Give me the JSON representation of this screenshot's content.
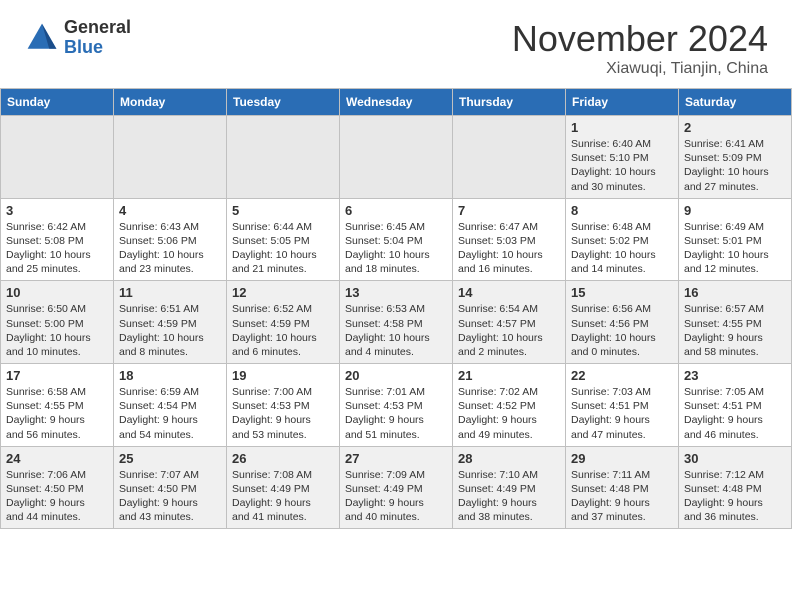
{
  "header": {
    "logo_general": "General",
    "logo_blue": "Blue",
    "month_title": "November 2024",
    "location": "Xiawuqi, Tianjin, China"
  },
  "weekdays": [
    "Sunday",
    "Monday",
    "Tuesday",
    "Wednesday",
    "Thursday",
    "Friday",
    "Saturday"
  ],
  "weeks": [
    [
      {
        "day": "",
        "info": ""
      },
      {
        "day": "",
        "info": ""
      },
      {
        "day": "",
        "info": ""
      },
      {
        "day": "",
        "info": ""
      },
      {
        "day": "",
        "info": ""
      },
      {
        "day": "1",
        "info": "Sunrise: 6:40 AM\nSunset: 5:10 PM\nDaylight: 10 hours\nand 30 minutes."
      },
      {
        "day": "2",
        "info": "Sunrise: 6:41 AM\nSunset: 5:09 PM\nDaylight: 10 hours\nand 27 minutes."
      }
    ],
    [
      {
        "day": "3",
        "info": "Sunrise: 6:42 AM\nSunset: 5:08 PM\nDaylight: 10 hours\nand 25 minutes."
      },
      {
        "day": "4",
        "info": "Sunrise: 6:43 AM\nSunset: 5:06 PM\nDaylight: 10 hours\nand 23 minutes."
      },
      {
        "day": "5",
        "info": "Sunrise: 6:44 AM\nSunset: 5:05 PM\nDaylight: 10 hours\nand 21 minutes."
      },
      {
        "day": "6",
        "info": "Sunrise: 6:45 AM\nSunset: 5:04 PM\nDaylight: 10 hours\nand 18 minutes."
      },
      {
        "day": "7",
        "info": "Sunrise: 6:47 AM\nSunset: 5:03 PM\nDaylight: 10 hours\nand 16 minutes."
      },
      {
        "day": "8",
        "info": "Sunrise: 6:48 AM\nSunset: 5:02 PM\nDaylight: 10 hours\nand 14 minutes."
      },
      {
        "day": "9",
        "info": "Sunrise: 6:49 AM\nSunset: 5:01 PM\nDaylight: 10 hours\nand 12 minutes."
      }
    ],
    [
      {
        "day": "10",
        "info": "Sunrise: 6:50 AM\nSunset: 5:00 PM\nDaylight: 10 hours\nand 10 minutes."
      },
      {
        "day": "11",
        "info": "Sunrise: 6:51 AM\nSunset: 4:59 PM\nDaylight: 10 hours\nand 8 minutes."
      },
      {
        "day": "12",
        "info": "Sunrise: 6:52 AM\nSunset: 4:59 PM\nDaylight: 10 hours\nand 6 minutes."
      },
      {
        "day": "13",
        "info": "Sunrise: 6:53 AM\nSunset: 4:58 PM\nDaylight: 10 hours\nand 4 minutes."
      },
      {
        "day": "14",
        "info": "Sunrise: 6:54 AM\nSunset: 4:57 PM\nDaylight: 10 hours\nand 2 minutes."
      },
      {
        "day": "15",
        "info": "Sunrise: 6:56 AM\nSunset: 4:56 PM\nDaylight: 10 hours\nand 0 minutes."
      },
      {
        "day": "16",
        "info": "Sunrise: 6:57 AM\nSunset: 4:55 PM\nDaylight: 9 hours\nand 58 minutes."
      }
    ],
    [
      {
        "day": "17",
        "info": "Sunrise: 6:58 AM\nSunset: 4:55 PM\nDaylight: 9 hours\nand 56 minutes."
      },
      {
        "day": "18",
        "info": "Sunrise: 6:59 AM\nSunset: 4:54 PM\nDaylight: 9 hours\nand 54 minutes."
      },
      {
        "day": "19",
        "info": "Sunrise: 7:00 AM\nSunset: 4:53 PM\nDaylight: 9 hours\nand 53 minutes."
      },
      {
        "day": "20",
        "info": "Sunrise: 7:01 AM\nSunset: 4:53 PM\nDaylight: 9 hours\nand 51 minutes."
      },
      {
        "day": "21",
        "info": "Sunrise: 7:02 AM\nSunset: 4:52 PM\nDaylight: 9 hours\nand 49 minutes."
      },
      {
        "day": "22",
        "info": "Sunrise: 7:03 AM\nSunset: 4:51 PM\nDaylight: 9 hours\nand 47 minutes."
      },
      {
        "day": "23",
        "info": "Sunrise: 7:05 AM\nSunset: 4:51 PM\nDaylight: 9 hours\nand 46 minutes."
      }
    ],
    [
      {
        "day": "24",
        "info": "Sunrise: 7:06 AM\nSunset: 4:50 PM\nDaylight: 9 hours\nand 44 minutes."
      },
      {
        "day": "25",
        "info": "Sunrise: 7:07 AM\nSunset: 4:50 PM\nDaylight: 9 hours\nand 43 minutes."
      },
      {
        "day": "26",
        "info": "Sunrise: 7:08 AM\nSunset: 4:49 PM\nDaylight: 9 hours\nand 41 minutes."
      },
      {
        "day": "27",
        "info": "Sunrise: 7:09 AM\nSunset: 4:49 PM\nDaylight: 9 hours\nand 40 minutes."
      },
      {
        "day": "28",
        "info": "Sunrise: 7:10 AM\nSunset: 4:49 PM\nDaylight: 9 hours\nand 38 minutes."
      },
      {
        "day": "29",
        "info": "Sunrise: 7:11 AM\nSunset: 4:48 PM\nDaylight: 9 hours\nand 37 minutes."
      },
      {
        "day": "30",
        "info": "Sunrise: 7:12 AM\nSunset: 4:48 PM\nDaylight: 9 hours\nand 36 minutes."
      }
    ]
  ]
}
